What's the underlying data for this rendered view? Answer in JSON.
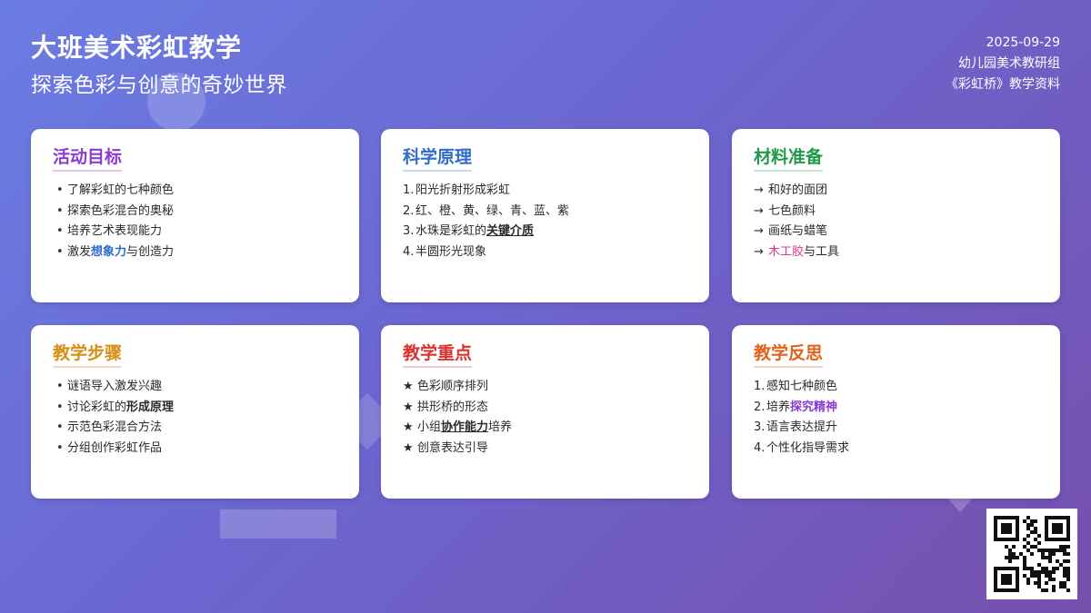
{
  "header": {
    "title": "大班美术彩虹教学",
    "subtitle": "探索色彩与创意的奇妙世界",
    "date": "2025-09-29",
    "organization": "幼儿园美术教研组",
    "material": "《彩虹桥》教学资料"
  },
  "colors": {
    "background_start": "#6a7de3",
    "background_end": "#7650ad",
    "goals_title": "#8a3bd1",
    "principles_title": "#2f6cc9",
    "materials_title": "#1f9a4a",
    "steps_title": "#d98e14",
    "focus_title": "#d9322f",
    "reflection_title": "#e0621b",
    "highlight_blue": "#2f6cc9",
    "highlight_pink": "#e0398e",
    "highlight_purple": "#8a3bd1"
  },
  "cards": {
    "goals": {
      "title": "活动目标",
      "items": [
        "了解彩虹的七种颜色",
        "探索色彩混合的奥秘",
        "培养艺术表现能力"
      ],
      "item4": {
        "pre": "激发",
        "highlight": "想象力",
        "post": "与创造力"
      }
    },
    "principles": {
      "title": "科学原理",
      "items": [
        {
          "num": "1.",
          "text": "阳光折射形成彩虹"
        },
        {
          "num": "2.",
          "text": "红、橙、黄、绿、青、蓝、紫"
        },
        {
          "num": "4.",
          "text": "半圆形光现象"
        }
      ],
      "item3": {
        "num": "3.",
        "pre": "水珠是彩虹的",
        "highlight": "关键介质"
      }
    },
    "materials": {
      "title": "材料准备",
      "arrow": "→",
      "items": [
        "和好的面团",
        "七色颜料",
        "画纸与蜡笔"
      ],
      "item4": {
        "highlight": "木工胶",
        "post": "与工具"
      }
    },
    "steps": {
      "title": "教学步骤",
      "items": [
        "谜语导入激发兴趣",
        "示范色彩混合方法",
        "分组创作彩虹作品"
      ],
      "item2": {
        "pre": "讨论彩虹的",
        "highlight": "形成原理"
      }
    },
    "focus": {
      "title": "教学重点",
      "star": "★",
      "items": [
        "色彩顺序排列",
        "拱形桥的形态",
        "创意表达引导"
      ],
      "item3": {
        "pre": "小组",
        "highlight": "协作能力",
        "post": "培养"
      }
    },
    "reflection": {
      "title": "教学反思",
      "items": [
        {
          "num": "1.",
          "text": "感知七种颜色"
        },
        {
          "num": "3.",
          "text": "语言表达提升"
        },
        {
          "num": "4.",
          "text": "个性化指导需求"
        }
      ],
      "item2": {
        "num": "2.",
        "pre": "培养",
        "highlight": "探究精神"
      }
    }
  }
}
